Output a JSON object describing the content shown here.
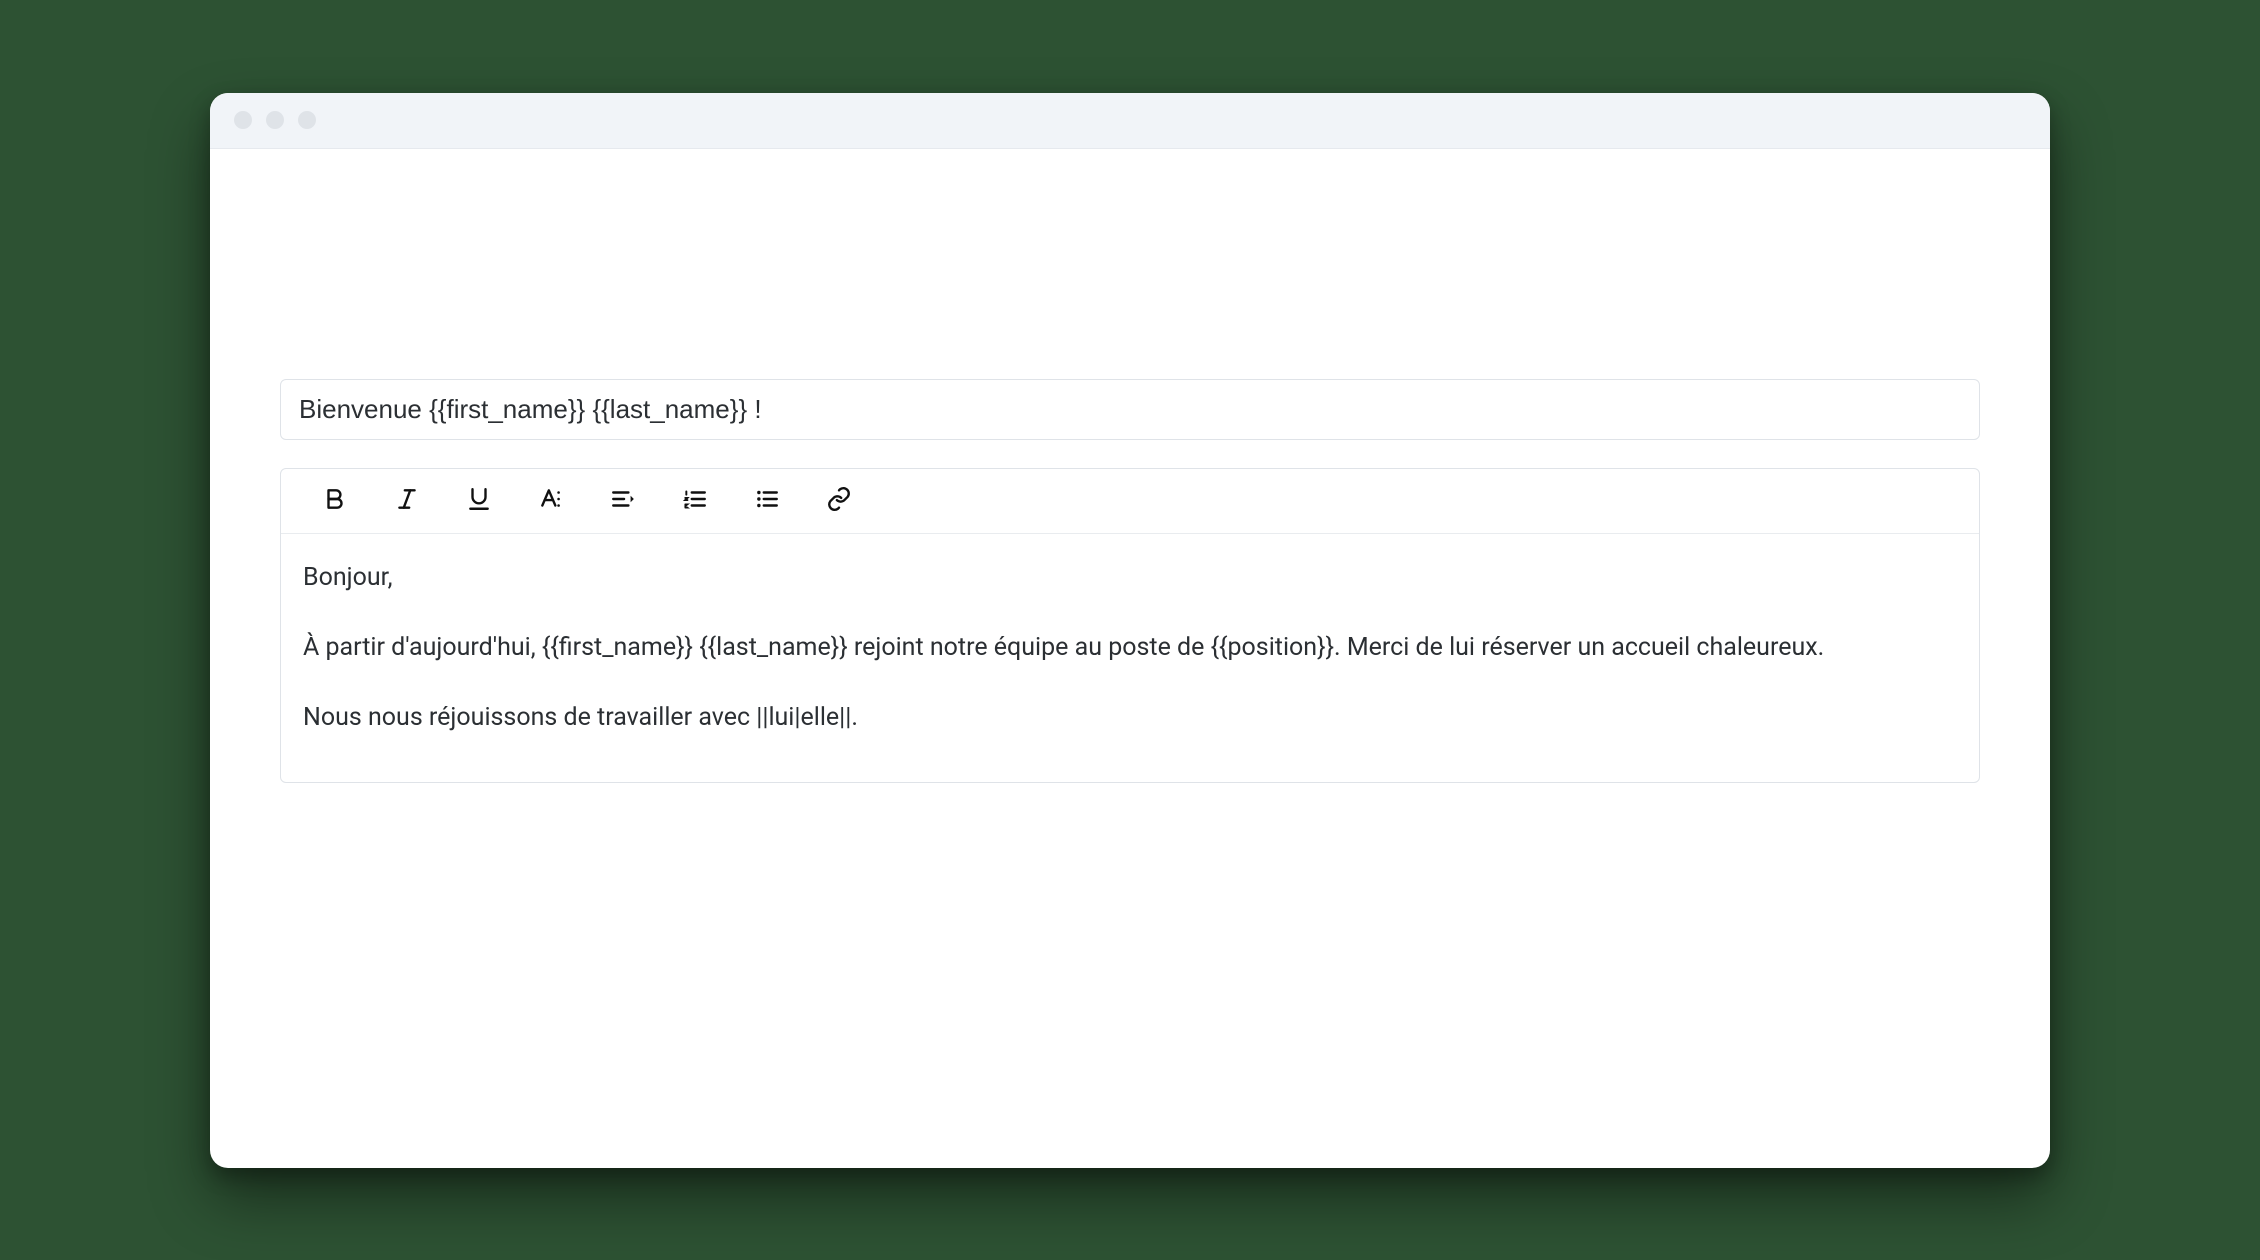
{
  "subject": "Bienvenue {{first_name}} {{last_name}} !",
  "body": {
    "p1": "Bonjour,",
    "p2": "À partir d'aujourd'hui, {{first_name}} {{last_name}} rejoint notre équipe au poste de {{position}}. Merci de lui réserver un accueil chaleureux.",
    "p3": "Nous nous réjouissons de travailler avec ||lui|elle||."
  },
  "toolbar": {
    "bold": "Bold",
    "italic": "Italic",
    "underline": "Underline",
    "textformat": "Text format",
    "align": "Align",
    "numbered": "Numbered list",
    "bulleted": "Bulleted list",
    "link": "Insert link"
  }
}
